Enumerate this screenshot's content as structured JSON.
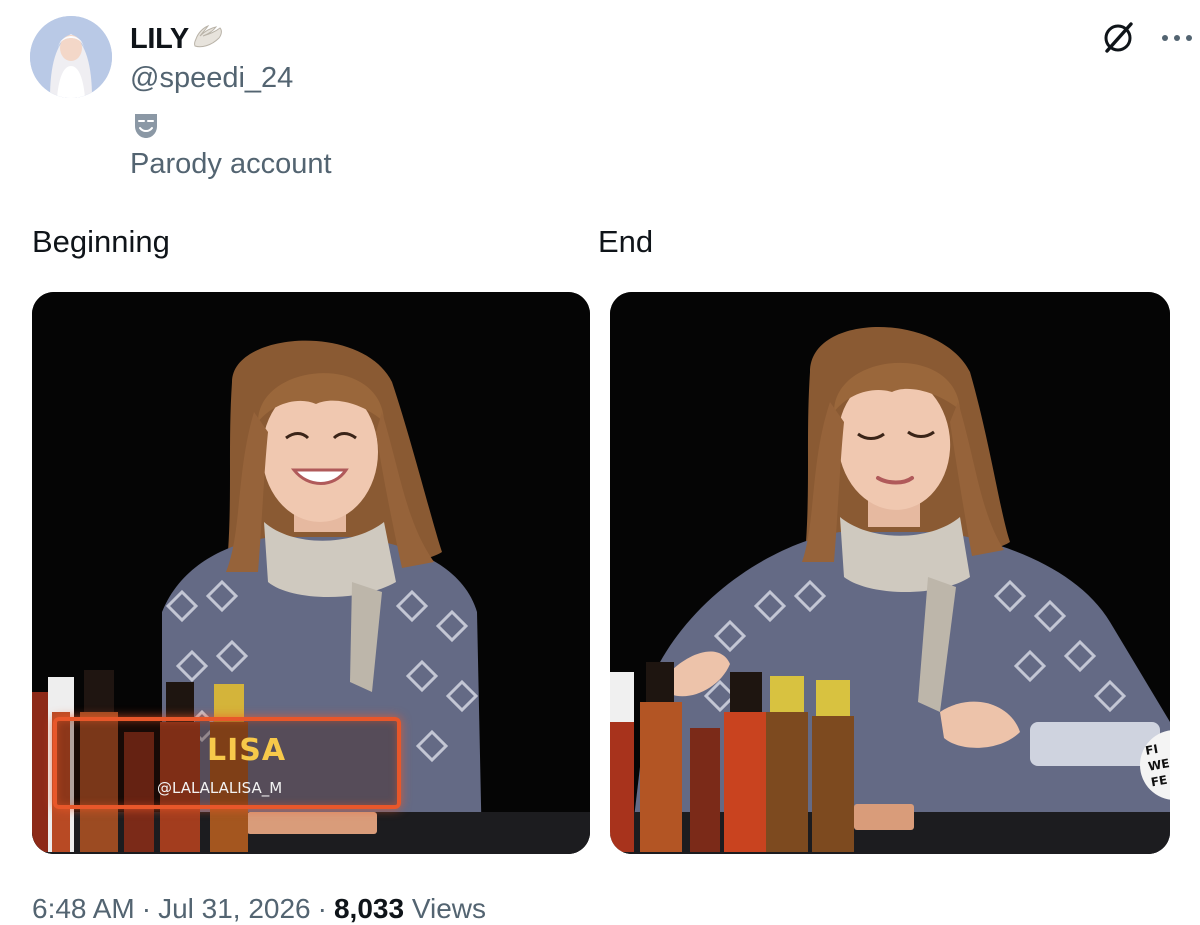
{
  "author": {
    "display_name": "LILY",
    "display_name_emoji": "wing-emoji",
    "handle": "@speedi_24",
    "account_label_icon": "theater-masks-icon",
    "account_label": "Parody account"
  },
  "header_actions": {
    "grok_icon": "grok-icon",
    "more_icon": "more-horizontal-icon"
  },
  "post": {
    "left_caption": "Beginning",
    "right_caption": "End",
    "media": [
      {
        "lower_third_name": "LISA",
        "lower_third_handle": "@LALALALISA_M"
      },
      {
        "badge_text": "FI WE FE"
      }
    ]
  },
  "meta": {
    "time": "6:48 AM",
    "separator": "·",
    "date": "Jul 31, 2026",
    "views_count": "8,033",
    "views_label": "Views"
  },
  "colors": {
    "text_primary": "#0f1419",
    "text_secondary": "#536471",
    "lower_third_border": "#e8572a",
    "lower_third_name": "#f7c94a"
  }
}
